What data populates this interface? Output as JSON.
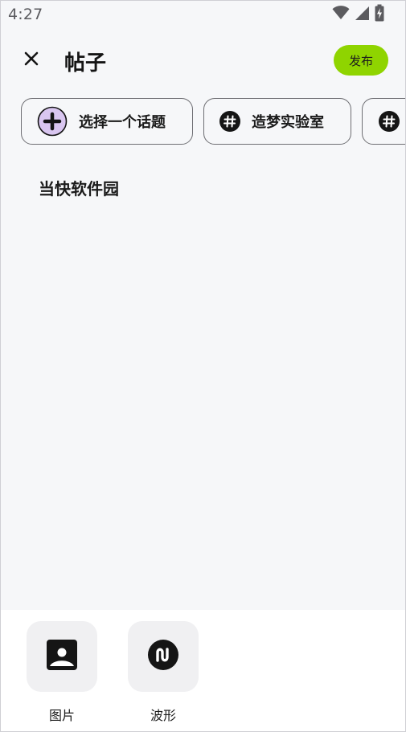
{
  "status_bar": {
    "time": "4:27",
    "icons": [
      "wifi-icon",
      "signal-icon",
      "battery-charging-icon"
    ]
  },
  "header": {
    "close_icon": "close-icon",
    "title": "帖子",
    "publish_label": "发布"
  },
  "topics": [
    {
      "label": "选择一个话题",
      "icon": "add-circle-icon"
    },
    {
      "label": "造梦实验室",
      "icon": "hashtag-icon"
    },
    {
      "label": "",
      "icon": "hashtag-icon"
    }
  ],
  "post": {
    "text": "当快软件园"
  },
  "tools": [
    {
      "label": "图片",
      "icon": "image-icon"
    },
    {
      "label": "波形",
      "icon": "waveform-icon"
    }
  ],
  "colors": {
    "accent": "#8fd400",
    "background": "#f6f7f9",
    "tool_tile": "#f0f0f2",
    "add_circle_fill": "#d9c6f0"
  }
}
